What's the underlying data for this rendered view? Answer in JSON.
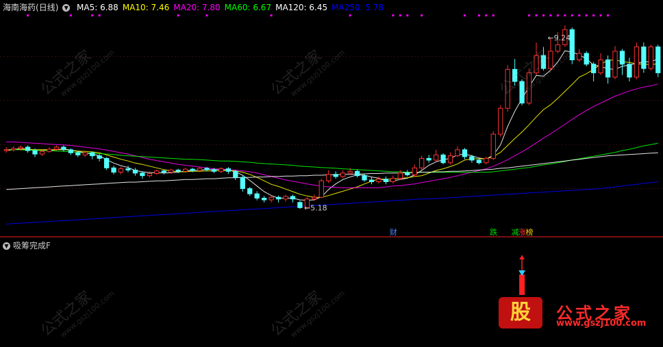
{
  "title": {
    "name": "海南海药",
    "period": "(日线)"
  },
  "legend": [
    {
      "label": "MA5: 6.88",
      "color": "#ffffff"
    },
    {
      "label": "MA10: 7.46",
      "color": "#ffff00"
    },
    {
      "label": "MA20: 7.80",
      "color": "#ff00ff"
    },
    {
      "label": "MA60: 6.67",
      "color": "#00ff00"
    },
    {
      "label": "MA120: 6.45",
      "color": "#ffffff"
    },
    {
      "label": "MA250: 5.78",
      "color": "#0000ff"
    }
  ],
  "sub_indicator": "吸筹完成F",
  "watermark": {
    "text": "公式之家",
    "url": "www.gszj100.com"
  },
  "brand": {
    "logo": "股",
    "name": "公式之家",
    "url": "www.gszj100.com"
  },
  "chart_data": {
    "type": "candlestick",
    "ylim": [
      4.6,
      9.7
    ],
    "annotations": [
      {
        "text": "9.24",
        "value": 9.24,
        "bar": 75
      },
      {
        "text": "5.18",
        "value": 5.18,
        "bar": 41
      }
    ],
    "markers": [
      {
        "text": "财",
        "bar": 54,
        "color": "#4488ff"
      },
      {
        "text": "跌",
        "bar": 68,
        "color": "#00dd00"
      },
      {
        "text": "减",
        "bar": 71,
        "color": "#00dd00"
      },
      {
        "text": "涨",
        "bar": 72,
        "color": "#ff3333"
      },
      {
        "text": "榜",
        "bar": 73,
        "color": "#ffcc00"
      }
    ],
    "top_dot_bars": [
      3,
      9,
      12,
      13,
      24,
      28,
      37,
      48,
      54,
      55,
      56,
      58,
      64,
      66,
      67,
      68,
      73,
      74,
      75,
      76,
      77,
      78,
      79,
      80,
      81,
      82,
      83,
      84
    ],
    "candles": [
      [
        6.5,
        6.52,
        6.58,
        6.45
      ],
      [
        6.52,
        6.55,
        6.6,
        6.48
      ],
      [
        6.55,
        6.58,
        6.62,
        6.5
      ],
      [
        6.58,
        6.5,
        6.62,
        6.45
      ],
      [
        6.5,
        6.42,
        6.55,
        6.35
      ],
      [
        6.42,
        6.48,
        6.52,
        6.38
      ],
      [
        6.48,
        6.53,
        6.58,
        6.45
      ],
      [
        6.53,
        6.58,
        6.62,
        6.5
      ],
      [
        6.58,
        6.52,
        6.62,
        6.48
      ],
      [
        6.52,
        6.45,
        6.55,
        6.4
      ],
      [
        6.45,
        6.4,
        6.5,
        6.35
      ],
      [
        6.4,
        6.45,
        6.5,
        6.35
      ],
      [
        6.45,
        6.38,
        6.48,
        6.3
      ],
      [
        6.38,
        6.32,
        6.42,
        6.25
      ],
      [
        6.32,
        6.1,
        6.35,
        6.05
      ],
      [
        6.1,
        6.0,
        6.15,
        5.95
      ],
      [
        6.0,
        6.08,
        6.12,
        5.95
      ],
      [
        6.08,
        6.05,
        6.15,
        6.0
      ],
      [
        6.05,
        5.98,
        6.1,
        5.92
      ],
      [
        5.98,
        5.92,
        6.02,
        5.85
      ],
      [
        5.92,
        5.97,
        6.02,
        5.88
      ],
      [
        5.97,
        6.03,
        6.06,
        5.94
      ],
      [
        6.03,
        6.0,
        6.06,
        5.95
      ],
      [
        6.0,
        6.05,
        6.08,
        5.96
      ],
      [
        6.05,
        6.02,
        6.08,
        5.98
      ],
      [
        6.02,
        6.07,
        6.1,
        5.99
      ],
      [
        6.07,
        6.04,
        6.1,
        6.0
      ],
      [
        6.04,
        6.09,
        6.12,
        6.0
      ],
      [
        6.09,
        6.06,
        6.12,
        6.02
      ],
      [
        6.06,
        6.02,
        6.1,
        5.98
      ],
      [
        6.02,
        6.08,
        6.12,
        5.98
      ],
      [
        6.08,
        6.02,
        6.12,
        5.96
      ],
      [
        6.02,
        5.88,
        6.05,
        5.82
      ],
      [
        5.88,
        5.62,
        5.92,
        5.55
      ],
      [
        5.62,
        5.5,
        5.66,
        5.45
      ],
      [
        5.5,
        5.4,
        5.56,
        5.35
      ],
      [
        5.4,
        5.36,
        5.45,
        5.3
      ],
      [
        5.36,
        5.42,
        5.46,
        5.3
      ],
      [
        5.42,
        5.38,
        5.46,
        5.3
      ],
      [
        5.38,
        5.44,
        5.48,
        5.32
      ],
      [
        5.44,
        5.38,
        5.48,
        5.3
      ],
      [
        5.3,
        5.18,
        5.34,
        5.15
      ],
      [
        5.18,
        5.38,
        5.42,
        5.15
      ],
      [
        5.38,
        5.42,
        5.48,
        5.34
      ],
      [
        5.42,
        5.8,
        5.85,
        5.4
      ],
      [
        5.8,
        5.95,
        6.05,
        5.75
      ],
      [
        5.95,
        5.9,
        6.02,
        5.85
      ],
      [
        5.9,
        5.98,
        6.05,
        5.86
      ],
      [
        5.98,
        6.02,
        6.1,
        5.94
      ],
      [
        6.02,
        5.92,
        6.06,
        5.88
      ],
      [
        5.92,
        5.82,
        5.96,
        5.78
      ],
      [
        5.82,
        5.78,
        5.88,
        5.72
      ],
      [
        5.78,
        5.84,
        5.9,
        5.74
      ],
      [
        5.84,
        5.78,
        5.9,
        5.72
      ],
      [
        5.78,
        5.86,
        5.92,
        5.74
      ],
      [
        5.86,
        5.98,
        6.05,
        5.82
      ],
      [
        5.98,
        5.94,
        6.05,
        5.9
      ],
      [
        5.94,
        6.1,
        6.18,
        5.9
      ],
      [
        6.1,
        6.32,
        6.38,
        6.05
      ],
      [
        6.32,
        6.28,
        6.4,
        6.22
      ],
      [
        6.28,
        6.4,
        6.52,
        6.24
      ],
      [
        6.4,
        6.22,
        6.44,
        6.18
      ],
      [
        6.22,
        6.38,
        6.46,
        6.18
      ],
      [
        6.38,
        6.52,
        6.6,
        6.35
      ],
      [
        6.52,
        6.36,
        6.56,
        6.3
      ],
      [
        6.36,
        6.28,
        6.4,
        6.22
      ],
      [
        6.28,
        6.22,
        6.32,
        6.18
      ],
      [
        6.22,
        6.32,
        6.36,
        6.18
      ],
      [
        6.32,
        6.88,
        6.95,
        6.28
      ],
      [
        6.88,
        7.48,
        7.55,
        6.82
      ],
      [
        7.48,
        8.38,
        8.48,
        7.4
      ],
      [
        8.38,
        8.1,
        8.62,
        8.0
      ],
      [
        8.1,
        7.6,
        8.15,
        7.55
      ],
      [
        7.6,
        8.3,
        8.4,
        7.55
      ],
      [
        8.3,
        8.7,
        9.0,
        8.25
      ],
      [
        8.7,
        8.4,
        8.9,
        8.35
      ],
      [
        8.4,
        8.8,
        9.1,
        8.35
      ],
      [
        8.8,
        8.95,
        9.24,
        8.75
      ],
      [
        8.95,
        9.3,
        9.4,
        8.9
      ],
      [
        9.3,
        8.6,
        9.35,
        8.5
      ],
      [
        8.6,
        8.75,
        8.85,
        8.55
      ],
      [
        8.75,
        8.5,
        8.8,
        8.45
      ],
      [
        8.5,
        8.3,
        8.55,
        8.1
      ],
      [
        8.3,
        8.6,
        8.75,
        8.25
      ],
      [
        8.6,
        8.2,
        8.7,
        8.05
      ],
      [
        8.2,
        8.8,
        8.92,
        8.15
      ],
      [
        8.8,
        8.5,
        8.85,
        8.25
      ],
      [
        8.5,
        8.2,
        8.65,
        8.1
      ],
      [
        8.2,
        8.9,
        9.0,
        8.15
      ],
      [
        8.9,
        8.4,
        9.0,
        8.3
      ],
      [
        8.4,
        8.9,
        8.95,
        8.35
      ],
      [
        8.9,
        8.3,
        8.95,
        8.2
      ]
    ],
    "series": [
      {
        "name": "MA5",
        "color": "#ffffff",
        "values": [
          6.5,
          6.52,
          6.55,
          6.53,
          6.51,
          6.51,
          6.5,
          6.52,
          6.54,
          6.51,
          6.48,
          6.45,
          6.42,
          6.38,
          6.29,
          6.21,
          6.15,
          6.11,
          6.04,
          6.01,
          5.99,
          5.99,
          5.98,
          5.99,
          6.0,
          6.03,
          6.04,
          6.05,
          6.06,
          6.06,
          6.06,
          6.05,
          6.01,
          5.93,
          5.81,
          5.68,
          5.55,
          5.46,
          5.4,
          5.4,
          5.4,
          5.36,
          5.35,
          5.36,
          5.43,
          5.6,
          5.73,
          5.83,
          5.89,
          5.94,
          5.93,
          5.89,
          5.86,
          5.8,
          5.8,
          5.83,
          5.86,
          5.94,
          6.04,
          6.16,
          6.24,
          6.29,
          6.32,
          6.4,
          6.42,
          6.38,
          6.33,
          6.3,
          6.4,
          6.63,
          7.06,
          7.41,
          7.7,
          7.98,
          8.24,
          8.22,
          8.36,
          8.55,
          8.81,
          8.78,
          8.72,
          8.62,
          8.48,
          8.45,
          8.39,
          8.38,
          8.45,
          8.48,
          8.52,
          8.56,
          8.55,
          8.63
        ]
      },
      {
        "name": "MA10",
        "color": "#ffff00",
        "values": [
          6.52,
          6.52,
          6.53,
          6.53,
          6.52,
          6.52,
          6.52,
          6.52,
          6.52,
          6.51,
          6.49,
          6.48,
          6.47,
          6.45,
          6.4,
          6.35,
          6.3,
          6.26,
          6.21,
          6.18,
          6.14,
          6.1,
          6.06,
          6.03,
          6.01,
          6.01,
          6.02,
          6.02,
          6.03,
          6.03,
          6.04,
          6.04,
          6.03,
          6.0,
          5.95,
          5.88,
          5.8,
          5.72,
          5.67,
          5.61,
          5.55,
          5.49,
          5.45,
          5.42,
          5.42,
          5.46,
          5.51,
          5.56,
          5.61,
          5.66,
          5.73,
          5.79,
          5.84,
          5.84,
          5.84,
          5.86,
          5.87,
          5.9,
          5.92,
          5.98,
          6.04,
          6.08,
          6.13,
          6.19,
          6.28,
          6.31,
          6.31,
          6.31,
          6.36,
          6.46,
          6.62,
          6.78,
          6.93,
          7.1,
          7.28,
          7.45,
          7.56,
          7.71,
          7.87,
          8.03,
          8.2,
          8.28,
          8.38,
          8.5,
          8.59,
          8.6,
          8.56,
          8.54,
          8.51,
          8.5,
          8.49,
          8.51
        ]
      },
      {
        "name": "MA20",
        "color": "#ff00ff",
        "values": [
          6.7,
          6.7,
          6.69,
          6.68,
          6.67,
          6.66,
          6.65,
          6.64,
          6.63,
          6.62,
          6.6,
          6.58,
          6.56,
          6.54,
          6.51,
          6.48,
          6.45,
          6.42,
          6.38,
          6.34,
          6.3,
          6.27,
          6.24,
          6.21,
          6.18,
          6.16,
          6.14,
          6.12,
          6.1,
          6.08,
          6.07,
          6.06,
          6.05,
          6.03,
          6.01,
          5.98,
          5.94,
          5.9,
          5.86,
          5.82,
          5.79,
          5.76,
          5.73,
          5.7,
          5.68,
          5.66,
          5.65,
          5.64,
          5.64,
          5.64,
          5.64,
          5.64,
          5.64,
          5.66,
          5.68,
          5.69,
          5.71,
          5.73,
          5.76,
          5.79,
          5.82,
          5.85,
          5.88,
          5.92,
          5.96,
          6.0,
          6.04,
          6.08,
          6.14,
          6.21,
          6.29,
          6.38,
          6.47,
          6.57,
          6.68,
          6.79,
          6.89,
          7.0,
          7.11,
          7.22,
          7.33,
          7.43,
          7.52,
          7.6,
          7.68,
          7.76,
          7.82,
          7.88,
          7.93,
          7.97,
          8.0,
          8.04
        ]
      },
      {
        "name": "MA60",
        "color": "#00ff00",
        "values": [
          6.52,
          6.52,
          6.52,
          6.51,
          6.51,
          6.5,
          6.5,
          6.49,
          6.48,
          6.47,
          6.46,
          6.45,
          6.44,
          6.43,
          6.42,
          6.41,
          6.39,
          6.38,
          6.37,
          6.36,
          6.35,
          6.34,
          6.33,
          6.32,
          6.31,
          6.3,
          6.3,
          6.29,
          6.28,
          6.27,
          6.26,
          6.26,
          6.25,
          6.24,
          6.23,
          6.21,
          6.2,
          6.19,
          6.18,
          6.17,
          6.16,
          6.14,
          6.13,
          6.12,
          6.11,
          6.1,
          6.09,
          6.08,
          6.07,
          6.06,
          6.05,
          6.04,
          6.03,
          6.02,
          6.01,
          6.01,
          6.0,
          6.0,
          6.0,
          6.0,
          6.0,
          6.0,
          6.0,
          6.0,
          6.0,
          6.0,
          6.0,
          6.0,
          6.01,
          6.03,
          6.05,
          6.07,
          6.09,
          6.11,
          6.14,
          6.17,
          6.19,
          6.22,
          6.25,
          6.28,
          6.31,
          6.34,
          6.37,
          6.4,
          6.43,
          6.46,
          6.5,
          6.53,
          6.57,
          6.61,
          6.64,
          6.67
        ]
      },
      {
        "name": "MA120",
        "color": "#ffffff",
        "values": [
          5.6,
          5.61,
          5.62,
          5.63,
          5.64,
          5.65,
          5.66,
          5.67,
          5.68,
          5.69,
          5.7,
          5.71,
          5.72,
          5.73,
          5.74,
          5.75,
          5.76,
          5.77,
          5.77,
          5.78,
          5.79,
          5.8,
          5.8,
          5.81,
          5.82,
          5.83,
          5.83,
          5.84,
          5.85,
          5.85,
          5.86,
          5.87,
          5.87,
          5.88,
          5.88,
          5.89,
          5.89,
          5.9,
          5.9,
          5.91,
          5.91,
          5.92,
          5.92,
          5.93,
          5.93,
          5.94,
          5.94,
          5.95,
          5.95,
          5.96,
          5.96,
          5.97,
          5.97,
          5.98,
          5.98,
          5.98,
          5.99,
          5.99,
          6.0,
          6.0,
          6.01,
          6.01,
          6.02,
          6.02,
          6.03,
          6.04,
          6.05,
          6.06,
          6.07,
          6.09,
          6.1,
          6.12,
          6.14,
          6.16,
          6.18,
          6.2,
          6.22,
          6.24,
          6.26,
          6.28,
          6.3,
          6.32,
          6.34,
          6.36,
          6.38,
          6.39,
          6.4,
          6.41,
          6.42,
          6.43,
          6.44,
          6.45
        ]
      },
      {
        "name": "MA250",
        "color": "#0000ff",
        "values": [
          4.8,
          4.81,
          4.82,
          4.83,
          4.84,
          4.85,
          4.86,
          4.87,
          4.88,
          4.89,
          4.9,
          4.91,
          4.92,
          4.93,
          4.94,
          4.95,
          4.96,
          4.97,
          4.98,
          4.99,
          5.0,
          5.01,
          5.02,
          5.03,
          5.04,
          5.05,
          5.06,
          5.07,
          5.08,
          5.09,
          5.1,
          5.11,
          5.12,
          5.13,
          5.14,
          5.15,
          5.16,
          5.17,
          5.18,
          5.19,
          5.2,
          5.21,
          5.22,
          5.23,
          5.24,
          5.25,
          5.26,
          5.27,
          5.28,
          5.29,
          5.3,
          5.31,
          5.32,
          5.33,
          5.34,
          5.35,
          5.36,
          5.37,
          5.38,
          5.38,
          5.39,
          5.4,
          5.41,
          5.42,
          5.43,
          5.44,
          5.45,
          5.46,
          5.47,
          5.48,
          5.49,
          5.5,
          5.51,
          5.52,
          5.53,
          5.54,
          5.55,
          5.56,
          5.57,
          5.58,
          5.59,
          5.6,
          5.61,
          5.62,
          5.64,
          5.66,
          5.68,
          5.7,
          5.72,
          5.74,
          5.76,
          5.78
        ]
      }
    ],
    "signal": {
      "bar": 72,
      "color": "#ff2020",
      "arrow_color": "#ff2020",
      "icon_color": "#33ccff"
    }
  }
}
